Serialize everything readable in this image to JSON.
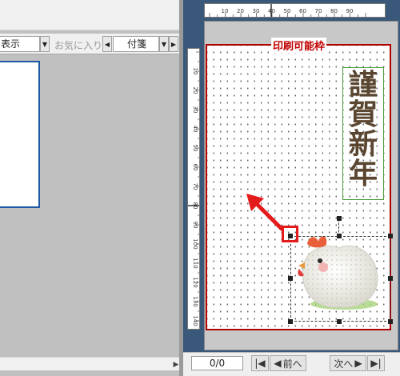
{
  "toolbar": {
    "view_combo": "表示",
    "favorites_label": "お気に入り",
    "category_combo": "付箋"
  },
  "canvas": {
    "printable_label": "印刷可能枠",
    "greeting_chars": [
      "謹",
      "賀",
      "新",
      "年"
    ],
    "h_ruler_ticks": [
      "10",
      "20",
      "30",
      "40",
      "50",
      "60",
      "70",
      "80",
      "90"
    ],
    "v_ruler_ticks": [
      "10",
      "20",
      "30",
      "40",
      "50",
      "60",
      "70",
      "80",
      "90",
      "100",
      "110",
      "120",
      "130",
      "140"
    ]
  },
  "pagination": {
    "page_counter": "0/0",
    "prev_label": "前へ",
    "next_label": "次へ"
  },
  "colors": {
    "workspace_blue": "#39587a",
    "printable_border": "#b00000",
    "highlight_red": "#e41b1b",
    "greeting_frame": "#4a9e3a"
  },
  "icons": {
    "arrow": "red-arrow-up-left-icon",
    "first": "first-page-icon",
    "prev": "previous-icon",
    "next": "next-icon",
    "last": "last-page-icon"
  }
}
